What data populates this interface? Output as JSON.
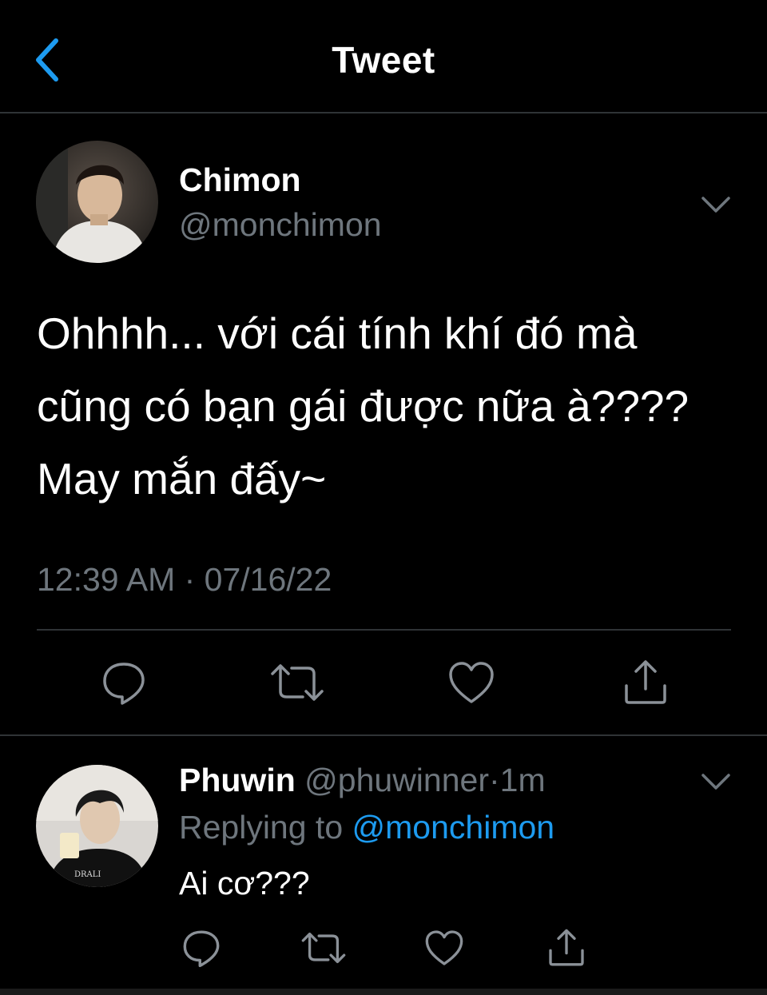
{
  "header": {
    "title": "Tweet",
    "back_icon": "chevron-left-icon",
    "accent_color": "#1d9bf0"
  },
  "tweet": {
    "author_name": "Chimon",
    "author_handle": "@monchimon",
    "text": "Ohhhh... với cái tính khí đó mà cũng có bạn gái được nữa à???? May mắn đấy~",
    "timestamp": "12:39 AM · 07/16/22",
    "actions": [
      "reply-icon",
      "retweet-icon",
      "like-icon",
      "share-icon"
    ]
  },
  "reply": {
    "author_name": "Phuwin",
    "author_handle": "@phuwinner",
    "separator": "·",
    "time": "1m",
    "replying_to_label": "Replying to",
    "replying_to_handle": "@monchimon",
    "text": "Ai cơ???",
    "actions": [
      "reply-icon",
      "retweet-icon",
      "like-icon",
      "share-icon"
    ]
  },
  "colors": {
    "background": "#000000",
    "text_primary": "#ffffff",
    "text_secondary": "#6e767d",
    "divider": "#2f3336",
    "link": "#1d9bf0"
  }
}
